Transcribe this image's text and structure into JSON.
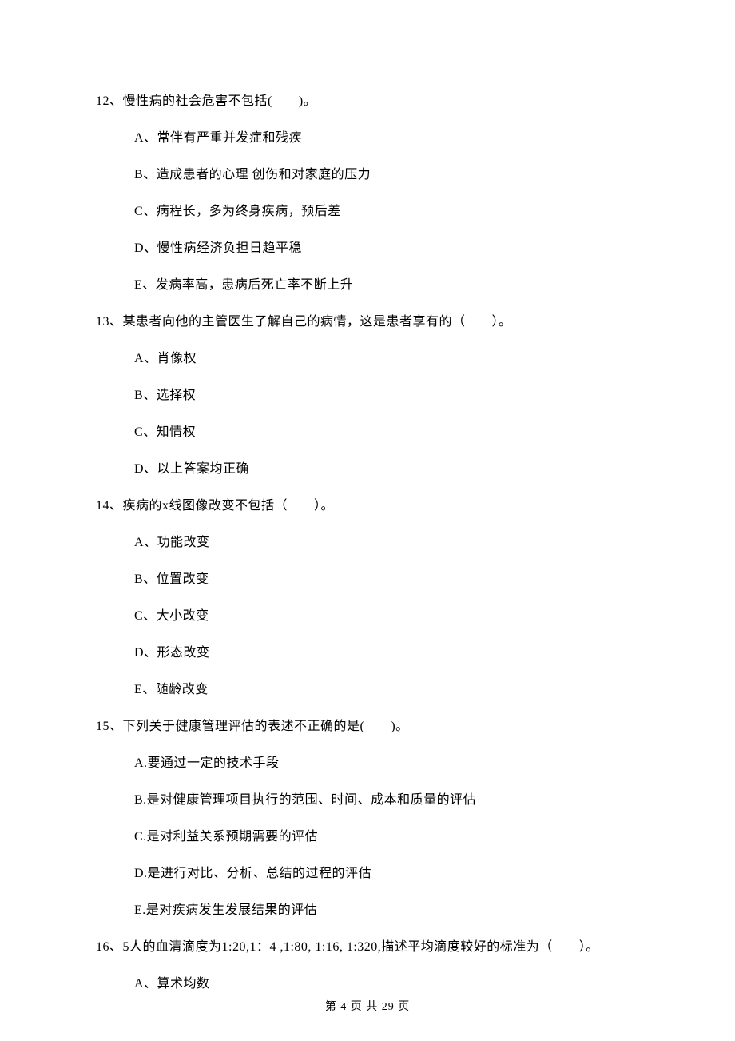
{
  "questions": [
    {
      "number": "12、",
      "text": "慢性病的社会危害不包括(　　)。",
      "options": [
        "A、常伴有严重并发症和残疾",
        "B、造成患者的心理 创伤和对家庭的压力",
        "C、病程长，多为终身疾病，预后差",
        "D、慢性病经济负担日趋平稳",
        "E、发病率高，患病后死亡率不断上升"
      ]
    },
    {
      "number": "13、",
      "text": "某患者向他的主管医生了解自己的病情，这是患者享有的（　　）。",
      "options": [
        "A、肖像权",
        "B、选择权",
        "C、知情权",
        "D、以上答案均正确"
      ]
    },
    {
      "number": "14、",
      "text": "疾病的x线图像改变不包括（　　）。",
      "options": [
        "A、功能改变",
        "B、位置改变",
        "C、大小改变",
        "D、形态改变",
        "E、随龄改变"
      ]
    },
    {
      "number": "15、",
      "text": "下列关于健康管理评估的表述不正确的是(　　)。",
      "options": [
        "A.要通过一定的技术手段",
        "B.是对健康管理项目执行的范围、时间、成本和质量的评估",
        "C.是对利益关系预期需要的评估",
        "D.是进行对比、分析、总结的过程的评估",
        "E.是对疾病发生发展结果的评估"
      ]
    },
    {
      "number": "16、",
      "text": "5人的血清滴度为1:20,1：4 ,1:80, 1:16, 1:320,描述平均滴度较好的标准为（　　）。",
      "options": [
        "A、算术均数"
      ]
    }
  ],
  "footer": "第 4 页 共 29 页"
}
